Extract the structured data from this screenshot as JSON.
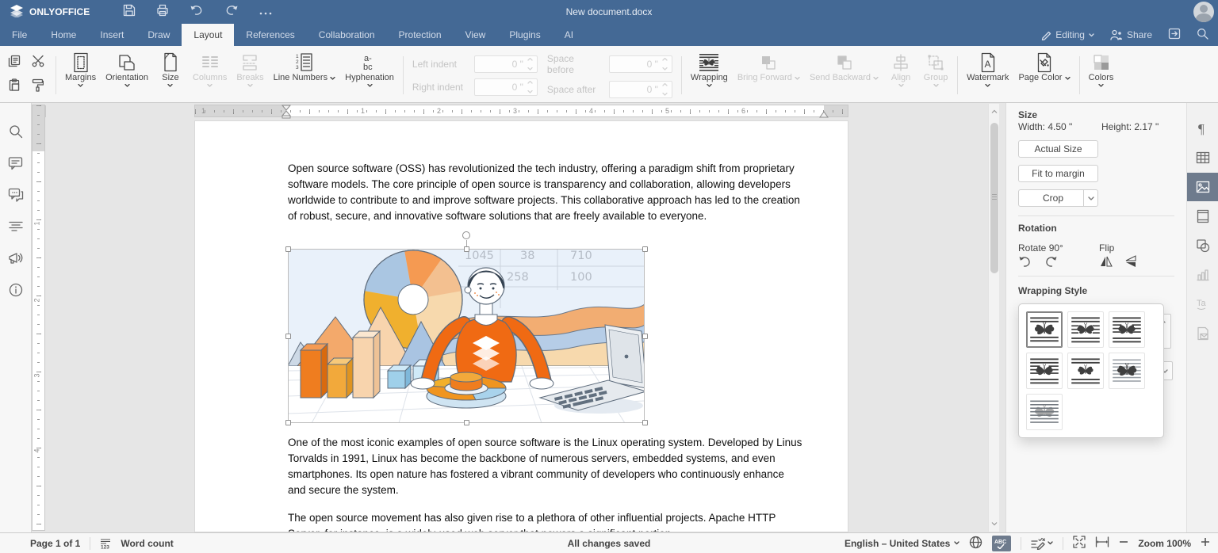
{
  "titlebar": {
    "app_name": "ONLYOFFICE",
    "doc_title": "New document.docx"
  },
  "tabs": {
    "items": [
      "File",
      "Home",
      "Insert",
      "Draw",
      "Layout",
      "References",
      "Collaboration",
      "Protection",
      "View",
      "Plugins",
      "AI"
    ],
    "active": "Layout"
  },
  "topbar_right": {
    "editing": "Editing",
    "share": "Share"
  },
  "toolbar": {
    "margins": "Margins",
    "orientation": "Orientation",
    "size": "Size",
    "columns": "Columns",
    "breaks": "Breaks",
    "line_numbers": "Line Numbers",
    "hyphenation": "Hyphenation",
    "left_indent": "Left indent",
    "right_indent": "Right indent",
    "space_before": "Space before",
    "space_after": "Space after",
    "indent_value": "0 \"",
    "wrapping": "Wrapping",
    "bring_forward": "Bring Forward",
    "send_backward": "Send Backward",
    "align": "Align",
    "group": "Group",
    "watermark": "Watermark",
    "page_color": "Page Color",
    "colors": "Colors"
  },
  "ruler": {
    "tab_selector": "L",
    "h": [
      "1",
      "1",
      "2",
      "3",
      "4",
      "5",
      "6"
    ],
    "v": [
      "1",
      "2",
      "3",
      "4"
    ]
  },
  "doc": {
    "p1": "Open source software (OSS) has revolutionized the tech industry, offering a paradigm shift from proprietary software models. The core principle of open source is transparency and collaboration, allowing developers worldwide to contribute to and improve software projects. This collaborative approach has led to the creation of robust, secure, and innovative software solutions that are freely available to everyone.",
    "p2": "One of the most iconic examples of open source software is the Linux operating system. Developed by Linus Torvalds in 1991, Linux has become the backbone of numerous servers, embedded systems, and even smartphones. Its open nature has fostered a vibrant community of developers who continuously enhance and secure the system.",
    "p3": "The open source movement has also given rise to a plethora of other influential projects. Apache HTTP Server, for instance, is a widely-used web server that powers a significant portion",
    "figure_numbers": [
      "1045",
      "38",
      "710",
      "258",
      "100"
    ]
  },
  "panel": {
    "size_heading": "Size",
    "width_label": "Width: 4.50 \"",
    "height_label": "Height: 2.17 \"",
    "actual_size": "Actual Size",
    "fit_to_margin": "Fit to margin",
    "crop": "Crop",
    "rotation_heading": "Rotation",
    "rotate_label": "Rotate 90°",
    "flip_label": "Flip",
    "wrapping_heading": "Wrapping Style",
    "wrapping_styles": [
      "Inline",
      "Square",
      "Tight",
      "Through",
      "Top and bottom",
      "In front",
      "Behind"
    ]
  },
  "statusbar": {
    "page": "Page 1 of 1",
    "word_count": "Word count",
    "saved": "All changes saved",
    "language": "English – United States",
    "zoom": "Zoom 100%"
  },
  "colors": {
    "header": "#446995",
    "accent_orange": "#f06a13",
    "active_tile": "#6e7b8d"
  }
}
